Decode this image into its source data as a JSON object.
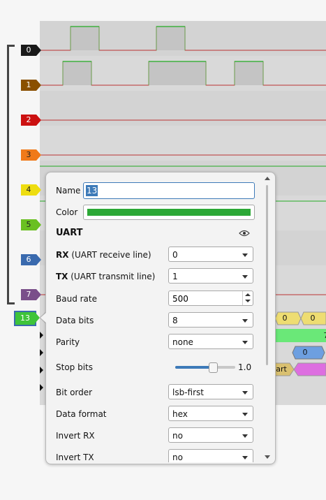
{
  "channels": [
    {
      "label": "0",
      "color": "#1a1a1a"
    },
    {
      "label": "1",
      "color": "#8a5000"
    },
    {
      "label": "2",
      "color": "#cc1111"
    },
    {
      "label": "3",
      "color": "#f07a1a"
    },
    {
      "label": "4",
      "color": "#eedd10"
    },
    {
      "label": "5",
      "color": "#6ac021"
    },
    {
      "label": "6",
      "color": "#3a6aae"
    },
    {
      "label": "7",
      "color": "#7a4f8a"
    }
  ],
  "decoder_label": {
    "label": "13",
    "color": "#3ec43a"
  },
  "annotations": {
    "row1": [
      "0",
      "0",
      "7"
    ],
    "row3": [
      "0"
    ],
    "row4": [
      "art"
    ]
  },
  "dialog": {
    "name_label": "Name",
    "name_value": "13",
    "color_label": "Color",
    "color_value": "#2ca836",
    "section_title": "UART",
    "visibility_icon": "eye-icon",
    "fields": {
      "rx": {
        "bold": "RX",
        "rest": " (UART receive line)",
        "value": "0"
      },
      "tx": {
        "bold": "TX",
        "rest": " (UART transmit line)",
        "value": "1"
      },
      "baud": {
        "label": "Baud rate",
        "value": "500"
      },
      "databits": {
        "label": "Data bits",
        "value": "8"
      },
      "parity": {
        "label": "Parity",
        "value": "none"
      },
      "stopbits": {
        "label": "Stop bits",
        "value": "1.0",
        "slider": 0.7
      },
      "bitorder": {
        "label": "Bit order",
        "value": "lsb-first"
      },
      "dataformat": {
        "label": "Data format",
        "value": "hex"
      },
      "invertrx": {
        "label": "Invert RX",
        "value": "no"
      },
      "inverttx": {
        "label": "Invert TX",
        "value": "no"
      }
    }
  }
}
